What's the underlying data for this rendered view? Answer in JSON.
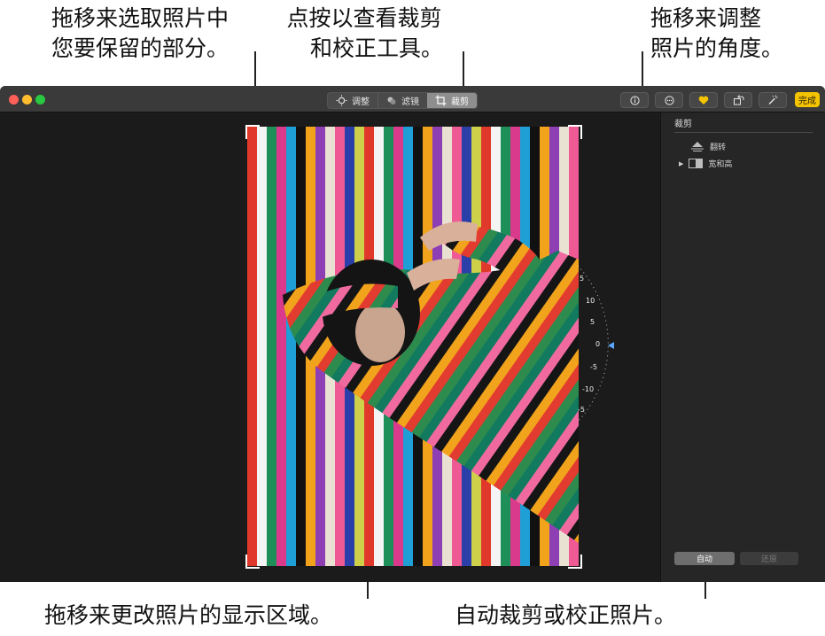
{
  "callouts": {
    "top_left": [
      "拖移来选取照片中",
      "您要保留的部分。"
    ],
    "top_center": [
      "点按以查看裁剪",
      "和校正工具。"
    ],
    "top_right": [
      "拖移来调整",
      "照片的角度。"
    ],
    "bottom_left": "拖移来更改照片的显示区域。",
    "bottom_right": "自动裁剪或校正照片。"
  },
  "toolbar": {
    "tabs": [
      {
        "label": "调整",
        "icon": "adjust-icon"
      },
      {
        "label": "滤镜",
        "icon": "filter-icon"
      },
      {
        "label": "裁剪",
        "icon": "crop-icon",
        "active": true
      }
    ],
    "info_icon": "info-icon",
    "more_icon": "ellipsis-icon",
    "favorite_icon": "heart-icon",
    "rotate_icon": "rotate-icon",
    "enhance_icon": "magic-wand-icon",
    "done_label": "完成",
    "colors": {
      "done": "#f5c400",
      "favorite": "#f5c400"
    }
  },
  "sidebar": {
    "title": "裁剪",
    "flip_label": "翻转",
    "aspect_label": "宽和高",
    "auto_label": "自动",
    "revert_label": "还原"
  },
  "dial": {
    "ticks": [
      "5",
      "10",
      "5",
      "0",
      "-5",
      "-10",
      "-5"
    ],
    "current": "0"
  }
}
